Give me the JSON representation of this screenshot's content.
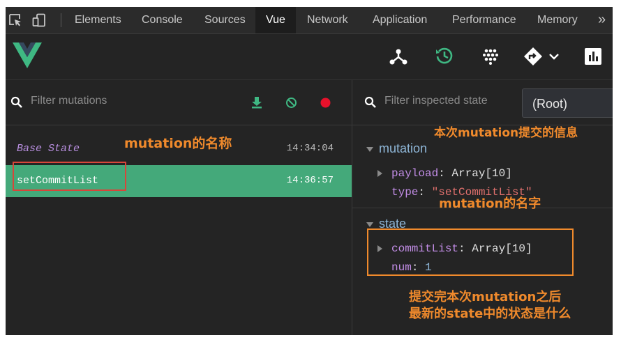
{
  "devtools": {
    "tabs": [
      "Elements",
      "Console",
      "Sources",
      "Vue",
      "Network",
      "Application",
      "Performance",
      "Memory"
    ],
    "active_tab": "Vue",
    "more": "»"
  },
  "vue_toolbar": {
    "icons": [
      "components-icon",
      "vuex-history-icon",
      "events-icon",
      "router-icon",
      "performance-chart-icon"
    ],
    "active": "vuex-history-icon",
    "accent": "#3fb883"
  },
  "mutations": {
    "filter_placeholder": "Filter mutations",
    "rows": [
      {
        "name": "Base State",
        "time": "14:34:04"
      },
      {
        "name": "setCommitList",
        "time": "14:36:57"
      }
    ],
    "selected": "setCommitList"
  },
  "inspector": {
    "filter_placeholder": "Filter inspected state",
    "root_select": "(Root)",
    "mutation_section": "mutation",
    "payload_key": "payload",
    "payload_value": "Array[10]",
    "type_key": "type",
    "type_value": "\"setCommitList\"",
    "state_section": "state",
    "commit_key": "commitList",
    "commit_value": "Array[10]",
    "num_key": "num",
    "num_value": "1"
  },
  "annotations": {
    "mutation_name": "mutation的名称",
    "commit_info": "本次mutation提交的信息",
    "mutation_name_2": "mutation的名字",
    "state_note_1": "提交完本次mutation之后",
    "state_note_2": "最新的state中的状态是什么"
  },
  "colors": {
    "annotation": "#f08a2c",
    "selected_row": "#44a97a"
  }
}
